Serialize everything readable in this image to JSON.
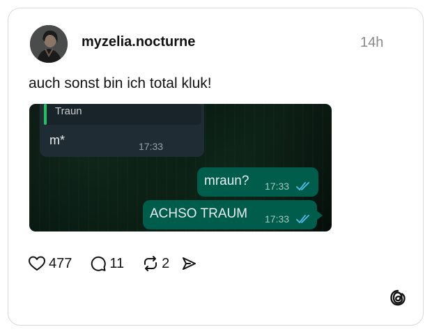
{
  "post": {
    "username": "myzelia.nocturne",
    "time": "14h",
    "text": "auch sonst bin ich total kluk!"
  },
  "chat": {
    "incoming": {
      "quote": "Traun",
      "message": "m*",
      "time": "17:33"
    },
    "outgoing": [
      {
        "message": "mraun?",
        "time": "17:33",
        "status": "read"
      },
      {
        "message": "ACHSO TRAUM",
        "time": "17:33",
        "status": "read"
      }
    ]
  },
  "actions": {
    "likes": "477",
    "replies": "11",
    "reposts": "2"
  },
  "icons": {
    "like": "heart-icon",
    "reply": "comment-bubble-icon",
    "repost": "repost-icon",
    "share": "send-icon",
    "brand": "threads-logo-icon"
  },
  "colors": {
    "bubble_out": "#005c4b",
    "bubble_in": "#1f2c33",
    "read_ticks": "#53bdeb",
    "quote_bar": "#21c063"
  }
}
